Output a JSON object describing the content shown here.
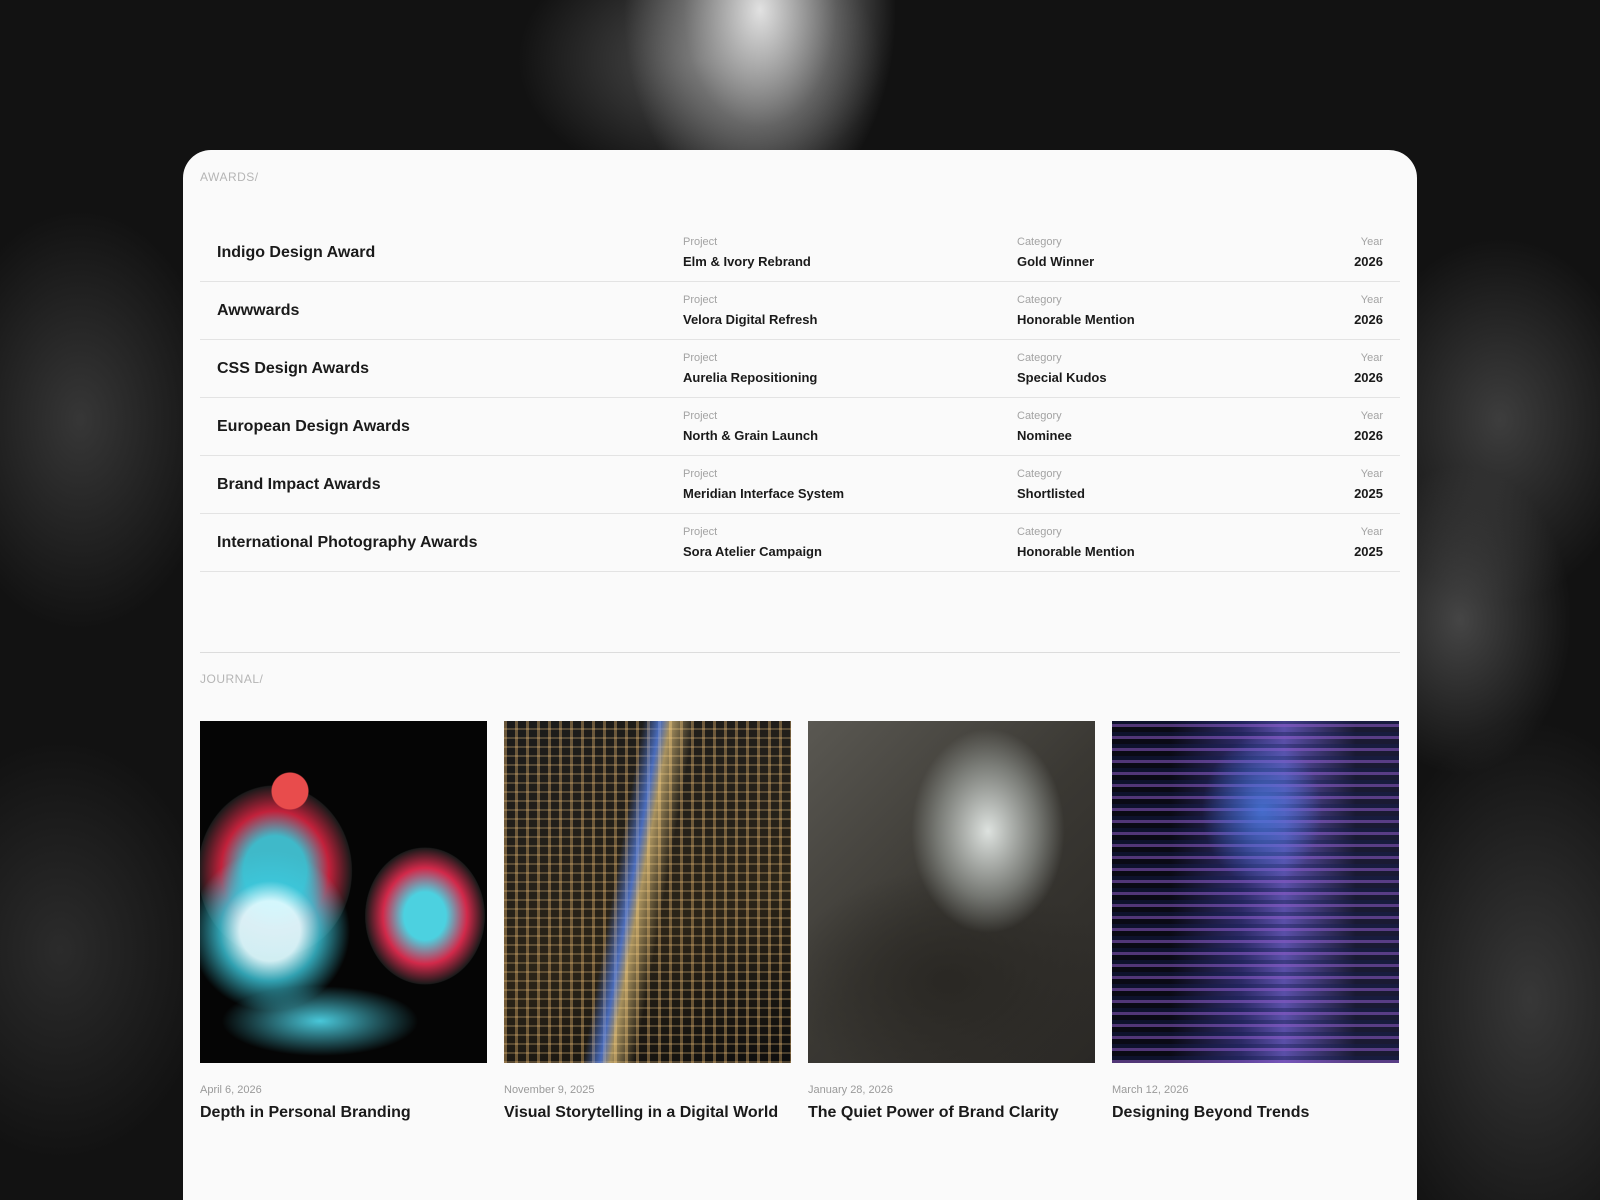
{
  "awards": {
    "section_label": "AWARDS/",
    "column_labels": {
      "project": "Project",
      "category": "Category",
      "year": "Year"
    },
    "rows": [
      {
        "name": "Indigo Design Award",
        "project": "Elm & Ivory Rebrand",
        "category": "Gold Winner",
        "year": "2026"
      },
      {
        "name": "Awwwards",
        "project": "Velora Digital Refresh",
        "category": "Honorable Mention",
        "year": "2026"
      },
      {
        "name": "CSS Design Awards",
        "project": "Aurelia Repositioning",
        "category": "Special Kudos",
        "year": "2026"
      },
      {
        "name": "European Design Awards",
        "project": "North & Grain Launch",
        "category": "Nominee",
        "year": "2026"
      },
      {
        "name": "Brand Impact Awards",
        "project": "Meridian Interface System",
        "category": "Shortlisted",
        "year": "2025"
      },
      {
        "name": "International Photography Awards",
        "project": "Sora Atelier Campaign",
        "category": "Honorable Mention",
        "year": "2025"
      }
    ]
  },
  "journal": {
    "section_label": "JOURNAL/",
    "posts": [
      {
        "date": "April 6, 2026",
        "title": "Depth in Personal Branding"
      },
      {
        "date": "November 9, 2025",
        "title": "Visual Storytelling in a Digital World"
      },
      {
        "date": "January 28, 2026",
        "title": "The Quiet Power of Brand Clarity"
      },
      {
        "date": "March 12, 2026",
        "title": "Designing Beyond Trends"
      }
    ]
  }
}
